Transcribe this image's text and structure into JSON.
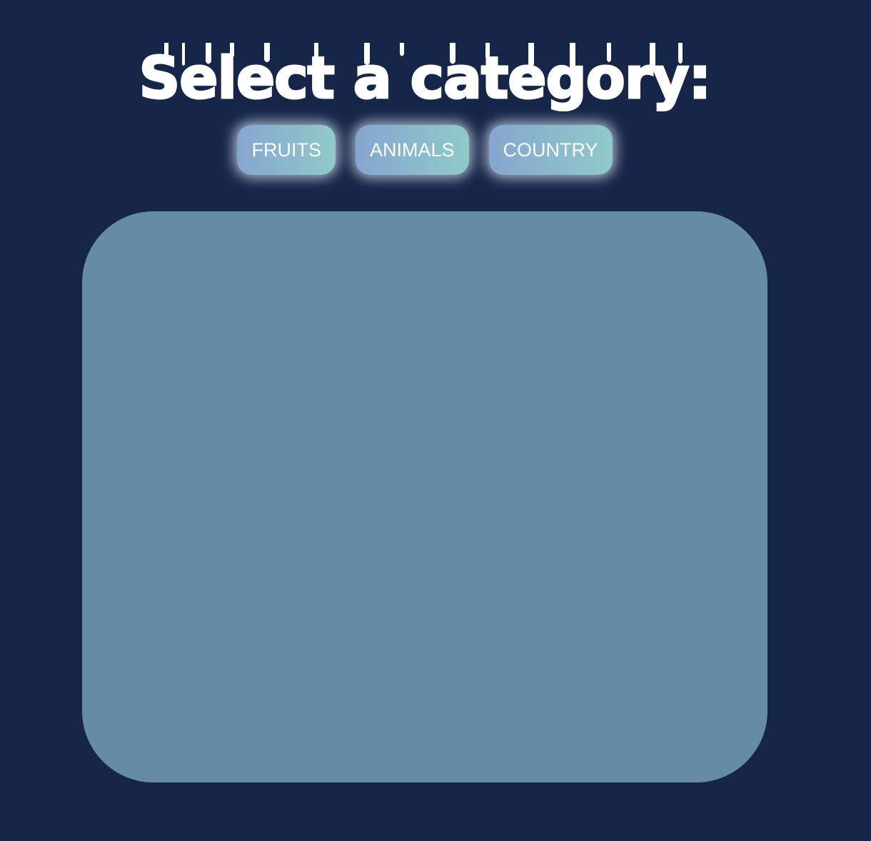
{
  "header": {
    "title": "Select a category:"
  },
  "categories": [
    {
      "label": "FRUITS"
    },
    {
      "label": "ANIMALS"
    },
    {
      "label": "COUNTRY"
    }
  ],
  "colors": {
    "background": "#152649",
    "board": "#668ba5",
    "button_gradient_start": "#86a6d0",
    "button_gradient_end": "#8fcac8",
    "text": "#ffffff"
  }
}
